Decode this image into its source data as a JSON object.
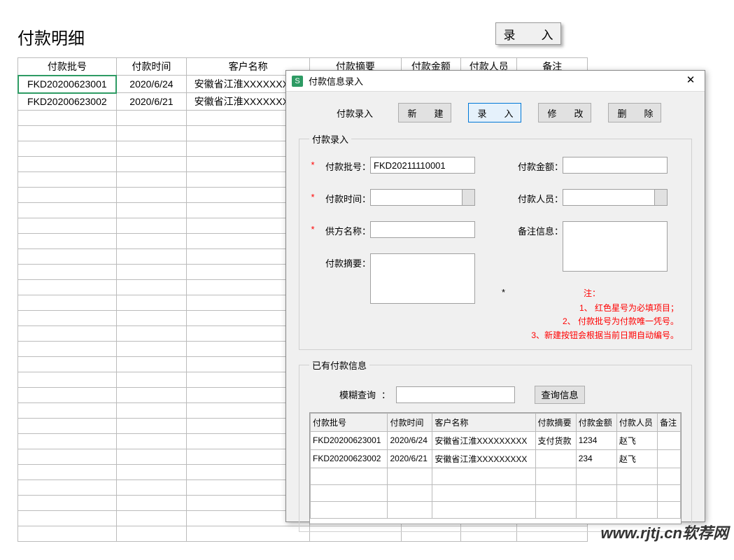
{
  "page": {
    "title": "付款明细",
    "enter_button": "录　入"
  },
  "table": {
    "headers": [
      "付款批号",
      "付款时间",
      "客户名称",
      "付款摘要",
      "付款金额",
      "付款人员",
      "备注"
    ],
    "rows": [
      {
        "batch": "FKD20200623001",
        "time": "2020/6/24",
        "customer": "安徽省江淮XXXXXXXXX",
        "summary": "",
        "amount": "",
        "person": "",
        "remark": ""
      },
      {
        "batch": "FKD20200623002",
        "time": "2020/6/21",
        "customer": "安徽省江淮XXXXXXXXX",
        "summary": "",
        "amount": "",
        "person": "",
        "remark": ""
      }
    ]
  },
  "dialog": {
    "title": "付款信息录入",
    "app_icon": "S",
    "toolbar": {
      "label": "付款录入",
      "new": "新　建",
      "enter": "录　入",
      "modify": "修　改",
      "delete": "删　除"
    },
    "entry_group": {
      "legend": "付款录入",
      "batch_label": "付款批号",
      "batch_value": "FKD20211110001",
      "time_label": "付款时间",
      "time_value": "",
      "supplier_label": "供方名称",
      "supplier_value": "",
      "summary_label": "付款摘要",
      "summary_value": "",
      "amount_label": "付款金额",
      "amount_value": "",
      "person_label": "付款人员",
      "person_value": "",
      "remark_label": "备注信息",
      "remark_value": "",
      "note_title": "注：",
      "note1": "1、 红色星号为必填项目；",
      "note2": "2、 付款批号为付款唯一凭号。",
      "note3": "3、新建按钮会根据当前日期自动编号。"
    },
    "exist_group": {
      "legend": "已有付款信息",
      "query_label": "模糊查询",
      "query_value": "",
      "query_btn": "查询信息",
      "headers": [
        "付款批号",
        "付款时间",
        "客户名称",
        "付款摘要",
        "付款金额",
        "付款人员",
        "备注"
      ],
      "rows": [
        {
          "batch": "FKD20200623001",
          "time": "2020/6/24",
          "customer": "安徽省江淮XXXXXXXXX",
          "summary": "支付货款",
          "amount": "1234",
          "person": "赵飞",
          "remark": ""
        },
        {
          "batch": "FKD20200623002",
          "time": "2020/6/21",
          "customer": "安徽省江淮XXXXXXXXX",
          "summary": "",
          "amount": "234",
          "person": "赵飞",
          "remark": ""
        }
      ]
    }
  },
  "watermark": "www.rjtj.cn软荐网"
}
